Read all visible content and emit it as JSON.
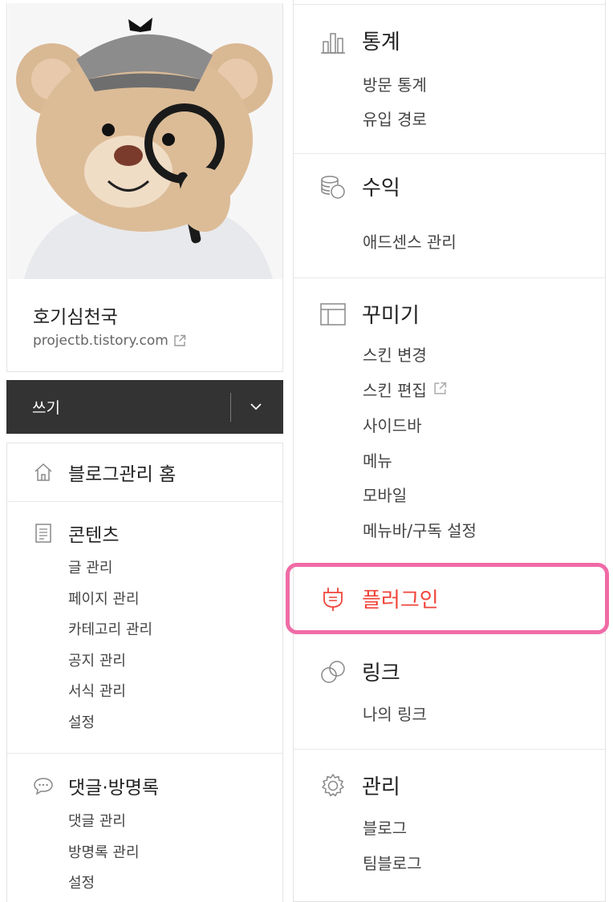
{
  "profile": {
    "blog_name": "호기심천국",
    "blog_url": "projectb.tistory.com"
  },
  "write": {
    "label": "쓰기"
  },
  "left_menu": {
    "home": {
      "label": "블로그관리 홈",
      "icon": "home-icon"
    },
    "contents": {
      "label": "콘텐츠",
      "icon": "document-icon",
      "items": [
        "글 관리",
        "페이지 관리",
        "카테고리 관리",
        "공지 관리",
        "서식 관리",
        "설정"
      ]
    },
    "comments": {
      "label": "댓글·방명록",
      "icon": "speech-bubble-icon",
      "items": [
        "댓글 관리",
        "방명록 관리",
        "설정"
      ]
    }
  },
  "right_menu": {
    "stats": {
      "label": "통계",
      "icon": "bar-chart-icon",
      "items": [
        "방문 통계",
        "유입 경로"
      ]
    },
    "revenue": {
      "label": "수익",
      "icon": "coins-icon",
      "items": [
        "애드센스 관리"
      ]
    },
    "design": {
      "label": "꾸미기",
      "icon": "layout-icon",
      "items": [
        "스킨 변경",
        "스킨 편집",
        "사이드바",
        "메뉴",
        "모바일",
        "메뉴바/구독 설정"
      ]
    },
    "plugin": {
      "label": "플러그인",
      "icon": "plug-icon",
      "color": "#f0443a",
      "highlight_color": "#f06ba6"
    },
    "link": {
      "label": "링크",
      "icon": "link-icon",
      "items": [
        "나의 링크"
      ]
    },
    "manage": {
      "label": "관리",
      "icon": "gear-icon",
      "items": [
        "블로그",
        "팀블로그"
      ]
    }
  }
}
